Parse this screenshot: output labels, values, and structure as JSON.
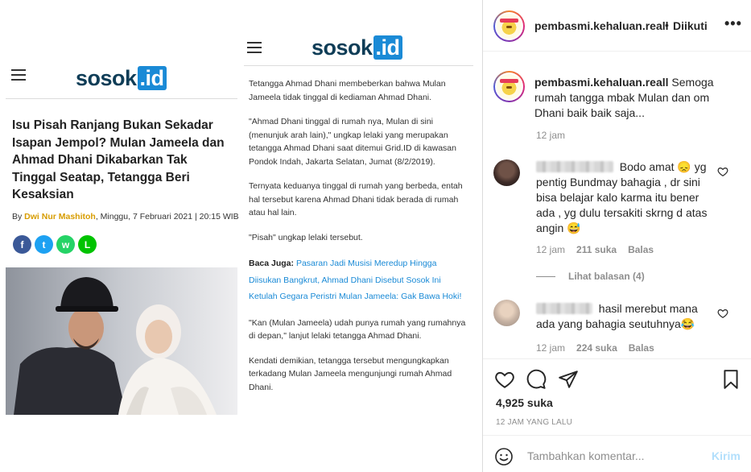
{
  "left_article": {
    "logo_word": "sosok",
    "logo_tld": ".id",
    "headline": "Isu Pisah Ranjang Bukan Sekadar Isapan Jempol? Mulan Jameela dan Ahmad Dhani Dikabarkan Tak Tinggal Seatap, Tetangga Beri Kesaksian",
    "byline_prefix": "By ",
    "author": "Dwi Nur Mashitoh",
    "byline_date": ", Minggu, 7 Februari 2021 | 20:15 WIB",
    "share_icons": [
      {
        "name": "facebook-icon",
        "glyph": "f",
        "color": "#3b5998"
      },
      {
        "name": "twitter-icon",
        "glyph": "t",
        "color": "#1da1f2"
      },
      {
        "name": "whatsapp-icon",
        "glyph": "w",
        "color": "#25d366"
      },
      {
        "name": "line-icon",
        "glyph": "L",
        "color": "#00c300"
      }
    ]
  },
  "middle_article": {
    "logo_word": "sosok",
    "logo_tld": ".id",
    "p1": "Tetangga Ahmad Dhani membeberkan bahwa Mulan Jameela tidak tinggal di kediaman Ahmad Dhani.",
    "p2": "\"Ahmad Dhani tinggal di rumah nya, Mulan di sini (menunjuk arah lain),\" ungkap lelaki yang merupakan tetangga Ahmad Dhani saat ditemui Grid.ID di kawasan Pondok Indah, Jakarta Selatan, Jumat (8/2/2019).",
    "p3": "Ternyata keduanya tinggal di rumah yang berbeda, entah hal tersebut karena Ahmad Dhani tidak berada di rumah atau hal lain.",
    "p4": "\"Pisah\" ungkap lelaki tersebut.",
    "baca_label": "Baca Juga: ",
    "baca_link": "Pasaran Jadi Musisi Meredup Hingga Diisukan Bangkrut, Ahmad Dhani Disebut Sosok Ini Ketulah Gegara Peristri Mulan Jameela: Gak Bawa Hoki!",
    "p5": "\"Kan (Mulan Jameela) udah punya rumah yang rumahnya di depan,\" lanjut lelaki tetangga Ahmad Dhani.",
    "p6": "Kendati demikian, tetangga tersebut mengungkapkan terkadang Mulan Jameela mengunjungi rumah Ahmad Dhani."
  },
  "instagram": {
    "username": "pembasmi.kehaluan.reall",
    "dot": "•",
    "follow_label": "Diikuti",
    "more": "•••",
    "caption_user": "pembasmi.kehaluan.reall",
    "caption_text": " Semoga rumah tangga mbak Mulan dan om Dhani baik baik saja...",
    "caption_time": "12 jam",
    "comments": [
      {
        "text": "Bodo amat 😞 yg pentig Bundmay bahagia , dr sini bisa belajar kalo karma itu bener ada , yg dulu tersakiti skrng d atas angin 😅",
        "time": "12 jam",
        "likes": "211 suka",
        "reply": "Balas"
      },
      {
        "text": "hasil merebut mana ada yang bahagia seutuhnya😂",
        "time": "12 jam",
        "likes": "224 suka",
        "reply": "Balas"
      }
    ],
    "view_replies": "Lihat balasan (4)",
    "likes_count": "4,925 suka",
    "post_time": "12 JAM YANG LALU",
    "comment_placeholder": "Tambahkan komentar...",
    "post_button": "Kirim",
    "colors": {
      "link_blue": "#1a8ad6",
      "author_gold": "#d79c00",
      "muted": "#8e8e8e",
      "post_disabled": "#b2dffc"
    }
  }
}
